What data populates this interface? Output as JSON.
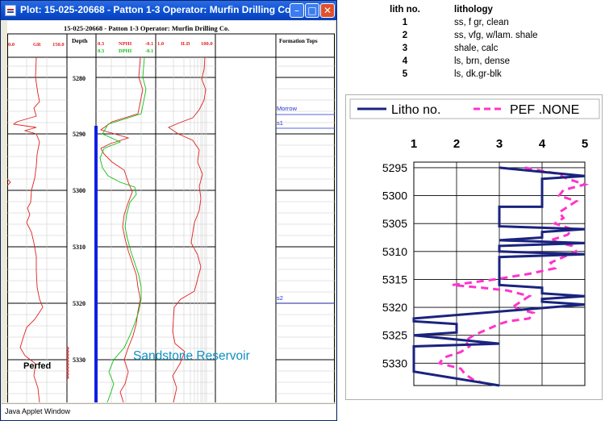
{
  "window": {
    "title": "Plot: 15-025-20668 - Patton 1-3  Operator: Murfin Drilling Co.",
    "status_text": "Java Applet Window"
  },
  "log_plot": {
    "header": "15-025-20668 - Patton 1-3  Operator: Murfin Drilling Co.",
    "gr_track": {
      "min": "0.0",
      "name": "GR",
      "max": "150.0"
    },
    "depth_label": "Depth",
    "neutron_density": {
      "min1": "0.3",
      "name1": "NPHI",
      "max1": "-0.1",
      "min2": "0.3",
      "name2": "DPHI",
      "max2": "-0.1"
    },
    "ild_track": {
      "min": "1.0",
      "name": "ILD",
      "max": "100.0"
    },
    "tops_label": "Formation Tops",
    "depth_ticks": [
      "5280",
      "5290",
      "5300",
      "5310",
      "5320",
      "5330"
    ],
    "tops": [
      "Morrow",
      "s1",
      "s2"
    ],
    "annotation_perfed": "Perfed",
    "annotation_reservoir": "Sandstone Reservoir",
    "colors": {
      "gr": "#e02020",
      "nphi": "#e02020",
      "dphi": "#10c010",
      "ild": "#e02020",
      "tops": "#2030d0",
      "reservoir_bar": "#1020e0",
      "reservoir_text": "#1090c0"
    }
  },
  "lithology_legend": {
    "col_no": "lith no.",
    "col_lith": "lithology",
    "rows": [
      {
        "no": "1",
        "lith": "ss, f gr, clean"
      },
      {
        "no": "2",
        "lith": "ss, vfg, w/lam. shale"
      },
      {
        "no": "3",
        "lith": "shale, calc"
      },
      {
        "no": "4",
        "lith": "ls, brn, dense"
      },
      {
        "no": "5",
        "lith": "ls, dk.gr-blk"
      }
    ]
  },
  "chart_data": {
    "type": "line",
    "title": "",
    "xlim": [
      1,
      5
    ],
    "ylim": [
      5294,
      5334
    ],
    "y_inverted": true,
    "x_ticks": [
      "1",
      "2",
      "3",
      "4",
      "5"
    ],
    "y_ticks": [
      "5295",
      "5300",
      "5305",
      "5310",
      "5315",
      "5320",
      "5325",
      "5330"
    ],
    "grid": true,
    "legend_position": "top",
    "series": [
      {
        "name": "Litho no.",
        "color": "#1a237e",
        "style": "solid",
        "points": [
          [
            3,
            5295
          ],
          [
            5,
            5296.5
          ],
          [
            4,
            5297
          ],
          [
            4,
            5302
          ],
          [
            3,
            5302
          ],
          [
            3,
            5305.5
          ],
          [
            5,
            5306
          ],
          [
            4,
            5306.5
          ],
          [
            4,
            5307.5
          ],
          [
            3,
            5308
          ],
          [
            5,
            5308.5
          ],
          [
            3,
            5309
          ],
          [
            3,
            5310
          ],
          [
            5,
            5310.5
          ],
          [
            3,
            5311
          ],
          [
            3,
            5316
          ],
          [
            4,
            5316.5
          ],
          [
            4,
            5317.5
          ],
          [
            5,
            5318
          ],
          [
            4,
            5318.5
          ],
          [
            4,
            5319
          ],
          [
            5,
            5319.5
          ],
          [
            1,
            5322
          ],
          [
            1,
            5322.5
          ],
          [
            2,
            5323
          ],
          [
            2,
            5324.5
          ],
          [
            1,
            5325
          ],
          [
            3,
            5326.5
          ],
          [
            1,
            5327
          ],
          [
            1,
            5331.5
          ],
          [
            3,
            5334
          ]
        ]
      },
      {
        "name": "PEF .NONE",
        "color": "#ff33cc",
        "style": "dashed",
        "points": [
          [
            3.6,
            5295
          ],
          [
            4.3,
            5296
          ],
          [
            4.6,
            5297
          ],
          [
            5,
            5298
          ],
          [
            4.5,
            5299
          ],
          [
            4.4,
            5300
          ],
          [
            4.8,
            5301
          ],
          [
            4.6,
            5302
          ],
          [
            4.4,
            5303
          ],
          [
            4.5,
            5304
          ],
          [
            4.3,
            5305
          ],
          [
            4.7,
            5306
          ],
          [
            4.6,
            5307
          ],
          [
            4.2,
            5308
          ],
          [
            4.7,
            5309
          ],
          [
            4.8,
            5310
          ],
          [
            4.5,
            5311
          ],
          [
            4.2,
            5312
          ],
          [
            4.3,
            5313
          ],
          [
            3.7,
            5314
          ],
          [
            2.9,
            5315
          ],
          [
            1.9,
            5316
          ],
          [
            2.6,
            5316.5
          ],
          [
            3.2,
            5317
          ],
          [
            3.7,
            5318
          ],
          [
            3.5,
            5319
          ],
          [
            3.3,
            5320
          ],
          [
            3.8,
            5321
          ],
          [
            3.7,
            5322
          ],
          [
            3.2,
            5322.5
          ],
          [
            3,
            5323
          ],
          [
            2.7,
            5324
          ],
          [
            2.4,
            5325
          ],
          [
            2.2,
            5326
          ],
          [
            2.3,
            5327
          ],
          [
            2.1,
            5328
          ],
          [
            1.7,
            5329
          ],
          [
            1.6,
            5330
          ],
          [
            2.1,
            5331
          ],
          [
            2.2,
            5332
          ],
          [
            2.4,
            5333
          ],
          [
            2.6,
            5333.5
          ]
        ]
      }
    ]
  }
}
